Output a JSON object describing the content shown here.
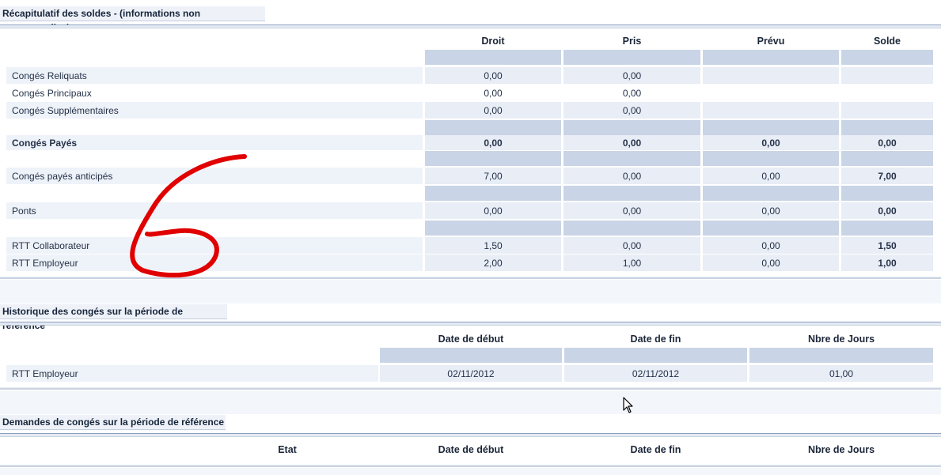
{
  "soldes": {
    "title": "Récapitulatif des soldes - (informations non contractuelles)",
    "headers": [
      "Droit",
      "Pris",
      "Prévu",
      "Solde"
    ],
    "rows": [
      {
        "label": "Congés Reliquats",
        "droit": "0,00",
        "pris": "0,00",
        "prevu": "",
        "solde": ""
      },
      {
        "label": "Congés Principaux",
        "droit": "0,00",
        "pris": "0,00",
        "prevu": "",
        "solde": ""
      },
      {
        "label": "Congés Supplémentaires",
        "droit": "0,00",
        "pris": "0,00",
        "prevu": "",
        "solde": ""
      },
      {
        "label": "Congés Payés",
        "droit": "0,00",
        "pris": "0,00",
        "prevu": "0,00",
        "solde": "0,00"
      },
      {
        "label": "Congés payés anticipés",
        "droit": "7,00",
        "pris": "0,00",
        "prevu": "0,00",
        "solde": "7,00"
      },
      {
        "label": "Ponts",
        "droit": "0,00",
        "pris": "0,00",
        "prevu": "0,00",
        "solde": "0,00"
      },
      {
        "label": "RTT Collaborateur",
        "droit": "1,50",
        "pris": "0,00",
        "prevu": "0,00",
        "solde": "1,50"
      },
      {
        "label": "RTT Employeur",
        "droit": "2,00",
        "pris": "1,00",
        "prevu": "0,00",
        "solde": "1,00"
      }
    ]
  },
  "historique": {
    "title": "Historique des congés sur la période de référence",
    "headers": [
      "Date de début",
      "Date de fin",
      "Nbre de Jours"
    ],
    "rows": [
      {
        "label": "RTT Employeur",
        "debut": "02/11/2012",
        "fin": "02/11/2012",
        "jours": "01,00"
      }
    ]
  },
  "demandes": {
    "title": "Demandes de congés sur la période de référence",
    "headers": [
      "Etat",
      "Date de début",
      "Date de fin",
      "Nbre de Jours"
    ]
  },
  "annotation": {
    "icon": "handwritten-six",
    "color": "#e00000"
  }
}
